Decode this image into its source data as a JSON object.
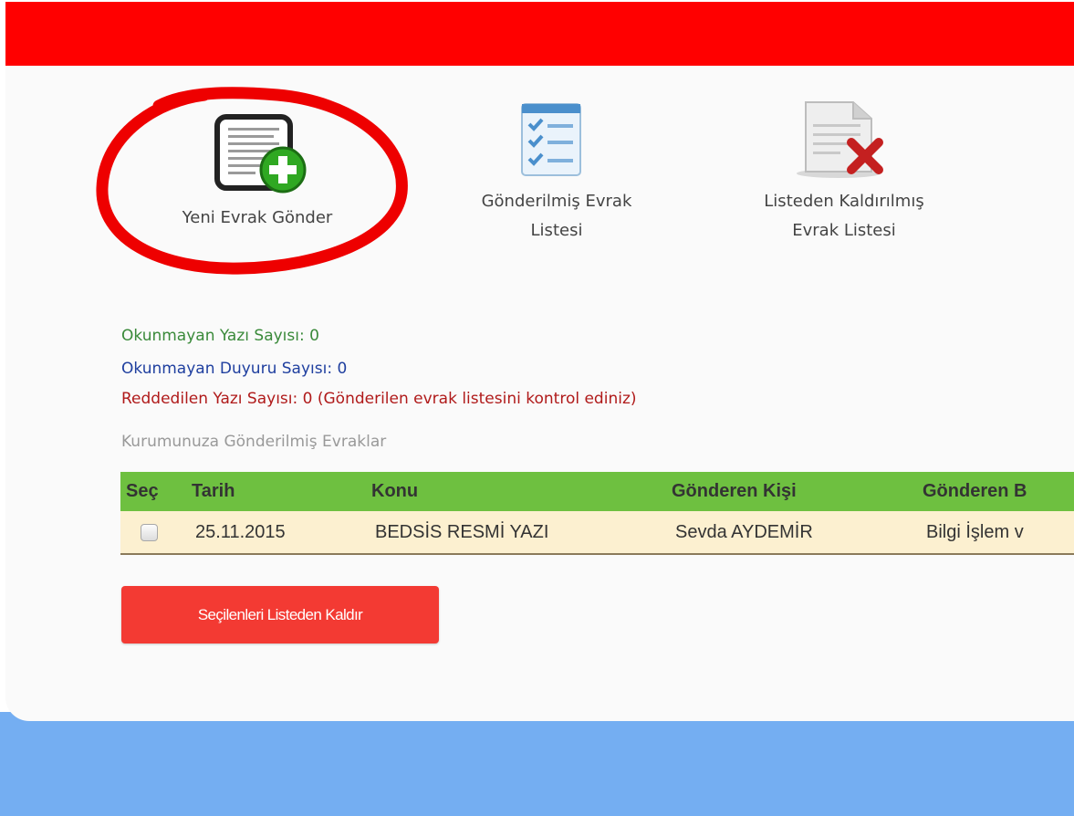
{
  "toolbar": {
    "items": [
      {
        "label": "Yeni Evrak Gönder",
        "icon": "document-add-icon"
      },
      {
        "label_line1": "Gönderilmiş Evrak",
        "label_line2": "Listesi",
        "icon": "checklist-icon"
      },
      {
        "label_line1": "Listeden Kaldırılmış",
        "label_line2": "Evrak Listesi",
        "icon": "document-remove-icon"
      }
    ]
  },
  "stats": {
    "unread_letters": "Okunmayan Yazı Sayısı: 0",
    "unread_announcements": "Okunmayan Duyuru Sayısı: 0",
    "rejected_letters": "Reddedilen Yazı Sayısı: 0 (Gönderilen evrak listesini kontrol ediniz)"
  },
  "section_title": "Kurumunuza Gönderilmiş Evraklar",
  "table": {
    "headers": [
      "Seç",
      "Tarih",
      "Konu",
      "Gönderen Kişi",
      "Gönderen B"
    ],
    "rows": [
      {
        "date": "25.11.2015",
        "subject": "BEDSİS RESMİ YAZI",
        "sender": "Sevda AYDEMİR",
        "sender_unit": "Bilgi İşlem v"
      }
    ]
  },
  "actions": {
    "remove_selected": "Seçilenleri Listeden Kaldır"
  },
  "colors": {
    "topbar": "#ff0000",
    "table_header": "#6ec040",
    "table_row": "#fcf0d0",
    "button": "#f33a33",
    "stat_green": "#3a8a3a",
    "stat_blue": "#1f3f9f",
    "stat_red": "#b01a1a",
    "footer": "#74aef2"
  }
}
